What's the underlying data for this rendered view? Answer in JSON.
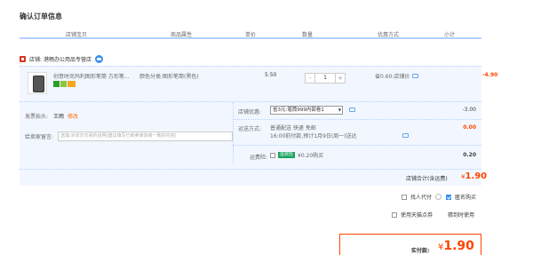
{
  "page_title": "确认订单信息",
  "header": {
    "columns": [
      "店铺宝贝",
      "商品属性",
      "单价",
      "数量",
      "优惠方式",
      "小计"
    ]
  },
  "shop": {
    "label": "店铺:",
    "name": "港畅办公用品专营店"
  },
  "item": {
    "title": "创意时尚玛利图形笔筒 方形笔...",
    "spec": "颜色分类:图形笔筒(黑色)",
    "price": "5.50",
    "qty": "1",
    "qty_minus": "-",
    "qty_plus": "+",
    "discount": "省0.60:店铺价",
    "subtotal": "-4.90"
  },
  "invoice": {
    "label": "发票抬头:",
    "value": "王雨",
    "link": "修改"
  },
  "message": {
    "label": "给卖家留言:",
    "placeholder": "选填:对本次交易的说明(建议填写已和卖家协商一致的内容)"
  },
  "coupon": {
    "label": "店铺优惠:",
    "selected": "省3元:笔筒999内部卷1",
    "value": "-3.00"
  },
  "shipping": {
    "label": "运送方式:",
    "line1": "普通配送 快递 免邮",
    "line2_prefix": "16:00前付款,",
    "line2_mid": "预计1月9日(周一)送达",
    "value": "0.00"
  },
  "insurance": {
    "label": "运费险:",
    "tag": "运费险",
    "price": "¥0.20购买",
    "value": "0.20"
  },
  "store_total": {
    "label": "店铺合计(含运费)",
    "currency": "¥",
    "value": "1.90"
  },
  "options": {
    "find_payer": "找人代付",
    "anonymous": "匿名购买",
    "tmall_points": "使用天猫点券",
    "points_note": "猜到时使用"
  },
  "final": {
    "label": "实付款:",
    "currency": "¥",
    "value": "1.90"
  },
  "colors": {
    "accent_red": "#ff4400",
    "header_rule": "#b2d1ff",
    "row_bg": "#f2f7ff"
  }
}
